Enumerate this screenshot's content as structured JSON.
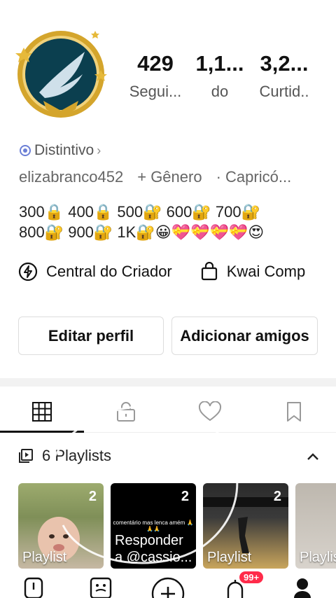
{
  "profile": {
    "stats": [
      {
        "value": "429",
        "label": "Segui..."
      },
      {
        "value": "1,1...",
        "label": "do"
      },
      {
        "value": "3,2...",
        "label": "Curtid.."
      }
    ],
    "badge_label": "Distintivo",
    "username": "elizabranco452",
    "gender": "+ Gênero",
    "sign": "Capricó...",
    "bio_line1": "300🔒 400🔒 500🔐 600🔐 700🔐",
    "bio_line2": "800🔐 900🔐 1K🔐😀💝💝💝💝😍"
  },
  "creator": {
    "central": "Central do Criador",
    "kwai": "Kwai Comp"
  },
  "buttons": {
    "edit": "Editar perfil",
    "add_friends": "Adicionar amigos"
  },
  "tabs": [
    {
      "icon": "grid-icon",
      "active": true
    },
    {
      "icon": "lock-icon",
      "active": false
    },
    {
      "icon": "heart-icon",
      "active": false
    },
    {
      "icon": "bookmark-icon",
      "active": false
    }
  ],
  "playlists": {
    "title": "6 Playlists",
    "items": [
      {
        "count": "2",
        "caption": "Playlist"
      },
      {
        "count": "2",
        "caption_line1": "Responder",
        "caption_line2": "a @cassio...",
        "overlay": "comentário mas lenca amém 🙏🙏🙏"
      },
      {
        "count": "2",
        "caption": "Playlist"
      },
      {
        "count": "",
        "caption": "Playlis"
      }
    ]
  },
  "bottom_nav": {
    "notif_count": "99+"
  },
  "colors": {
    "accent_badge": "#ff2b4a",
    "avatar_ring": "#d4a52c",
    "avatar_bg": "#0b3f4f"
  }
}
